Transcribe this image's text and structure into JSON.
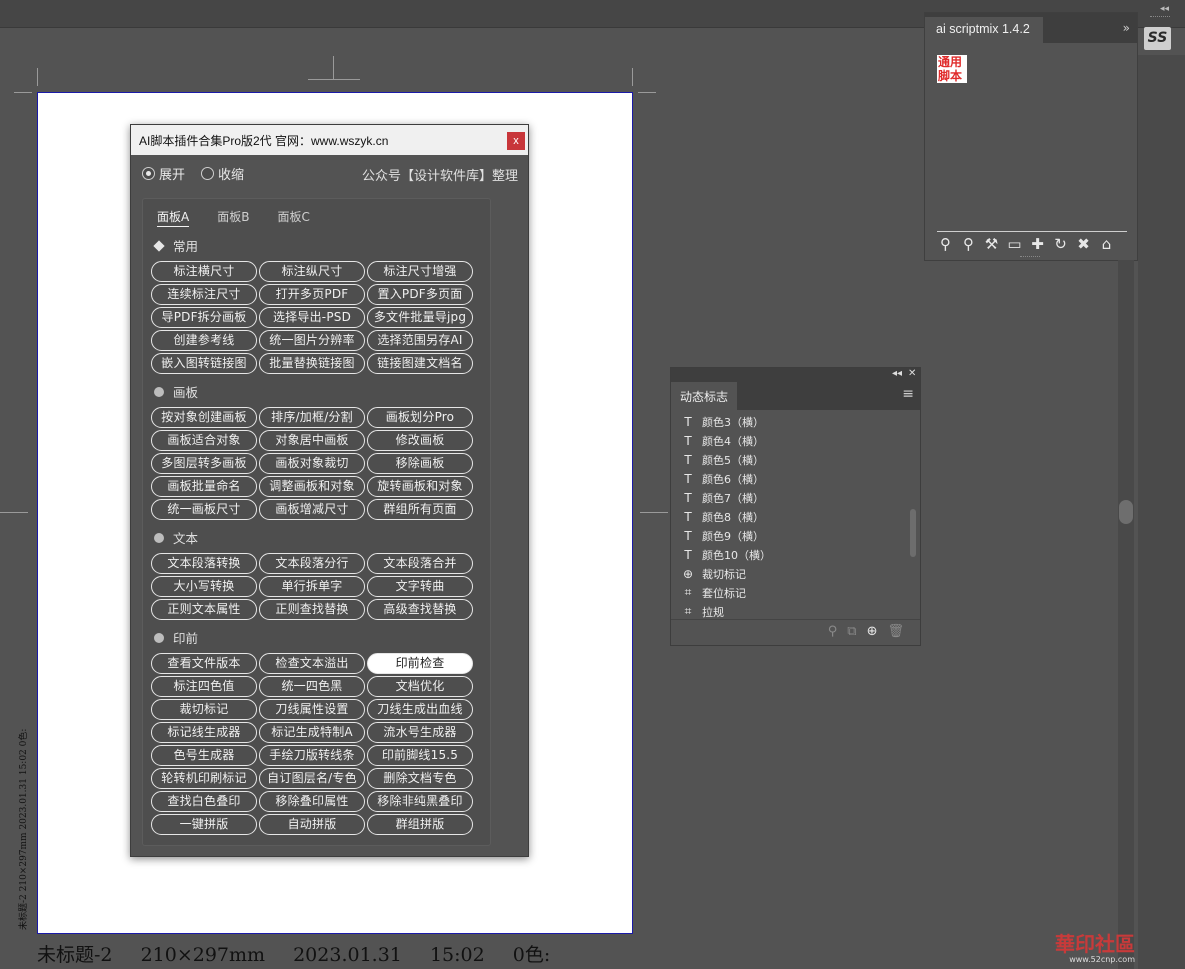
{
  "document": {
    "slug_vertical": "未标题-2    210×297mm    2023.01.31    15:02    0色:",
    "slug_bottom": [
      "未标题-2",
      "210×297mm",
      "2023.01.31",
      "15:02",
      "0色:"
    ]
  },
  "script_panel": {
    "title": "AI脚本插件合集Pro版2代 官网：www.wszyk.cn",
    "close_label": "x",
    "radio_expand": "展开",
    "radio_collapse": "收缩",
    "credit": "公众号【设计软件库】整理",
    "tabs": [
      "面板A",
      "面板B",
      "面板C"
    ],
    "sections": [
      {
        "label": "常用",
        "buttons": [
          "标注横尺寸",
          "标注纵尺寸",
          "标注尺寸增强",
          "连续标注尺寸",
          "打开多页PDF",
          "置入PDF多页面",
          "导PDF拆分画板",
          "选择导出-PSD",
          "多文件批量导jpg",
          "创建参考线",
          "统一图片分辨率",
          "选择范围另存AI",
          "嵌入图转链接图",
          "批量替换链接图",
          "链接图建文档名"
        ]
      },
      {
        "label": "画板",
        "buttons": [
          "按对象创建画板",
          "排序/加框/分割",
          "画板划分Pro",
          "画板适合对象",
          "对象居中画板",
          "修改画板",
          "多图层转多画板",
          "画板对象裁切",
          "移除画板",
          "画板批量命名",
          "调整画板和对象",
          "旋转画板和对象",
          "统一画板尺寸",
          "画板增减尺寸",
          "群组所有页面"
        ]
      },
      {
        "label": "文本",
        "buttons": [
          "文本段落转换",
          "文本段落分行",
          "文本段落合并",
          "大小写转换",
          "单行拆单字",
          "文字转曲",
          "正则文本属性",
          "正则查找替换",
          "高级查找替换"
        ]
      },
      {
        "label": "印前",
        "buttons": [
          "查看文件版本",
          "检查文本溢出",
          "印前检查",
          "标注四色值",
          "统一四色黑",
          "文档优化",
          "裁切标记",
          "刀线属性设置",
          "刀线生成出血线",
          "标记线生成器",
          "标记生成特制A",
          "流水号生成器",
          "色号生成器",
          "手绘刀版转线条",
          "印前脚线15.5",
          "轮转机印刷标记",
          "自订图层名/专色",
          "删除文档专色",
          "查找白色叠印",
          "移除叠印属性",
          "移除非纯黑叠印",
          "一键拼版",
          "自动拼版",
          "群组拼版"
        ]
      }
    ],
    "selected_button": "印前检查"
  },
  "scriptmix_panel": {
    "tab_label": "ai scriptmix 1.4.2",
    "expand_glyph": "»",
    "red_label": "通用脚本",
    "icons": [
      "user-minus-icon",
      "user-add-icon",
      "wrench-icon",
      "folder-icon",
      "plus-icon",
      "refresh-icon",
      "close-icon",
      "home-icon"
    ]
  },
  "right_toolbar": {
    "ss_label": "SS",
    "collapse_glyph": "◂◂"
  },
  "symbols_panel": {
    "tab_label": "动态标志",
    "menu_glyph": "≡",
    "items": [
      {
        "icon": "text-icon",
        "label": "颜色3（横）"
      },
      {
        "icon": "text-icon",
        "label": "颜色4（横）"
      },
      {
        "icon": "text-icon",
        "label": "颜色5（横）"
      },
      {
        "icon": "text-icon",
        "label": "颜色6（横）"
      },
      {
        "icon": "text-icon",
        "label": "颜色7（横）"
      },
      {
        "icon": "text-icon",
        "label": "颜色8（横）"
      },
      {
        "icon": "text-icon",
        "label": "颜色9（横）"
      },
      {
        "icon": "text-icon",
        "label": "颜色10（横）"
      },
      {
        "icon": "crosshair-icon",
        "label": "裁切标记"
      },
      {
        "icon": "frame-icon",
        "label": "套位标记"
      },
      {
        "icon": "frame-icon",
        "label": "拉规"
      }
    ]
  },
  "watermark": {
    "brand": "華印社區",
    "url": "www.52cnp.com"
  },
  "colors": {
    "workspace": "#535353",
    "panel_title_bg": "#f0f0f0",
    "close_red": "#c8363a",
    "artboard_border": "#1a1aa8",
    "label_red": "#e02b2b"
  }
}
